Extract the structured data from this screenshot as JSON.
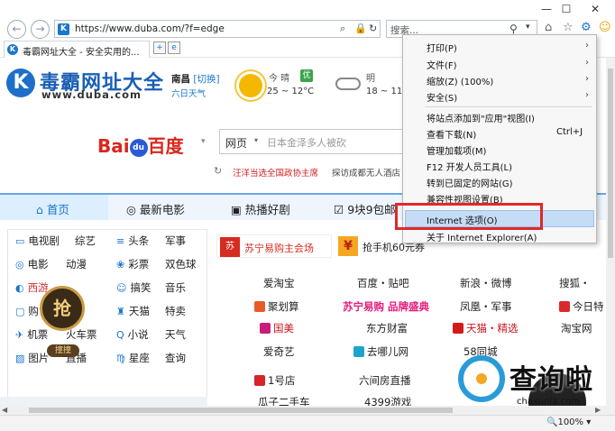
{
  "window": {
    "minimize": "—",
    "maximize": "☐",
    "close": "✕"
  },
  "toolbar": {
    "back": "←",
    "forward": "→",
    "url": "https://www.duba.com/?f=edge",
    "search_placeholder": "搜索...",
    "home_icon": "home-icon",
    "favorites_icon": "star-icon",
    "tools_icon": "gear-icon",
    "feedback_icon": "smiley-icon"
  },
  "tabs": [
    {
      "label": "毒霸网址大全 - 安全实用的..."
    }
  ],
  "header": {
    "logo_mark": "K",
    "logo_text": "毒霸网址大全",
    "logo_url": "www.duba.com",
    "city": "南昌",
    "city_switch": "[切换]",
    "forecast_link": "六日天气",
    "today_label": "今 晴",
    "today_temp": "25 ~ 12°C",
    "aqi": "优",
    "tomorrow_label": "明",
    "tomorrow_temp": "18 ~ 11°"
  },
  "baidu": {
    "brand_left": "Bai",
    "brand_mark": "du",
    "brand_right": "百度",
    "engine": "网页",
    "placeholder": "日本金泽多人被砍",
    "hot1": "汪洋当选全国政协主席",
    "hot2": "探访成都无人酒店"
  },
  "nav": {
    "items": [
      {
        "label": "首页"
      },
      {
        "label": "最新电影"
      },
      {
        "label": "热播好剧"
      },
      {
        "label": "9块9包邮"
      }
    ]
  },
  "left": {
    "rows": [
      [
        "电视剧",
        "综艺",
        "头条",
        "军事"
      ],
      [
        "电影",
        "动漫",
        "彩票",
        "双色球"
      ],
      [
        "西游",
        "",
        "搞笑",
        "音乐"
      ],
      [
        "购",
        "",
        "天猫",
        "特卖"
      ],
      [
        "机票",
        "火车票",
        "小说",
        "天气"
      ],
      [
        "图片",
        "直播",
        "星座",
        "查询"
      ]
    ],
    "qiang": "抢",
    "qiang_label": "撞撞"
  },
  "promos": [
    {
      "icon": "苏",
      "label": "苏宁易购主会场"
    },
    {
      "icon": "¥",
      "label": "抢手机60元券"
    }
  ],
  "sites": [
    [
      "爱淘宝",
      "百度・贴吧",
      "新浪・微博",
      "搜狐・"
    ],
    [
      "聚划算",
      "苏宁易购 品牌盛典",
      "凤凰・军事",
      "今日特"
    ],
    [
      "国美",
      "东方财富",
      "天猫・精选",
      "淘宝网"
    ],
    [
      "爱奇艺",
      "去哪儿网",
      "58同城",
      ""
    ],
    [
      "1号店",
      "六间房直播",
      "",
      ""
    ],
    [
      "瓜子二手车",
      "4399游戏",
      "",
      ""
    ]
  ],
  "menu": {
    "items": [
      {
        "label": "打印(P)",
        "arrow": "›"
      },
      {
        "label": "文件(F)",
        "arrow": "›"
      },
      {
        "label": "缩放(Z) (100%)",
        "arrow": "›"
      },
      {
        "label": "安全(S)",
        "arrow": "›"
      },
      {
        "label": "将站点添加到\"应用\"视图(I)"
      },
      {
        "label": "查看下载(N)",
        "shortcut": "Ctrl+J"
      },
      {
        "label": "管理加载项(M)"
      },
      {
        "label": "F12 开发人员工具(L)"
      },
      {
        "label": "转到已固定的网站(G)"
      },
      {
        "label": "兼容性视图设置(B)"
      },
      {
        "label": "Internet 选项(O)"
      },
      {
        "label": "关于 Internet Explorer(A)"
      }
    ]
  },
  "status": {
    "zoom": "100%"
  },
  "watermark": {
    "text": "查询啦",
    "sub": "chaxunla.com"
  },
  "colors": {
    "accent": "#1b76cc",
    "highlight_box": "#e0282a",
    "menu_highlight": "#c4dcf5"
  }
}
